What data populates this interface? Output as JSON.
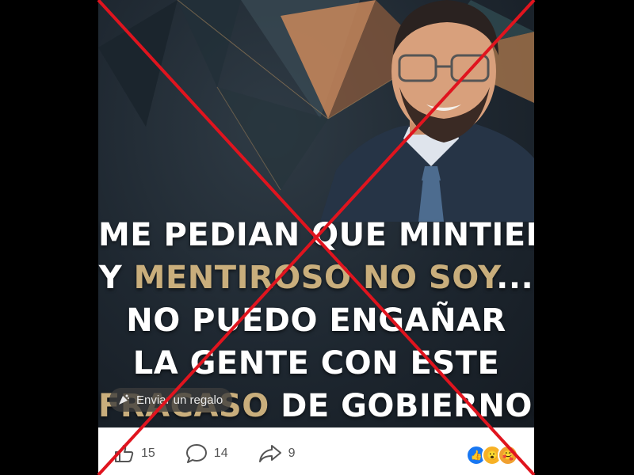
{
  "post": {
    "caption_lines": [
      {
        "white_a": "ME PEDIAN QUE MINTIERA",
        "gold": "",
        "white_b": ""
      },
      {
        "white_a": "Y ",
        "gold": "MENTIROSO NO SOY",
        "white_b": "..."
      },
      {
        "white_a": "NO PUEDO ENGAÑAR",
        "gold": "",
        "white_b": ""
      },
      {
        "white_a": "LA GENTE CON ESTE",
        "gold": "",
        "white_b": ""
      },
      {
        "white_a": "",
        "gold": "FRACASO",
        "white_b": " DE GOBIERNO."
      }
    ],
    "gift_button": "Enviar un regalo"
  },
  "actions": {
    "likes": "15",
    "comments": "14",
    "shares": "9"
  },
  "icons": [
    "like-icon",
    "comment-icon",
    "share-icon",
    "gift-icon",
    "like-reaction-icon",
    "wow-reaction-icon",
    "care-reaction-icon"
  ],
  "colors": {
    "cross": "#e0141e",
    "gold_text": "#c9ae7c",
    "like_blue": "#1877f2"
  }
}
